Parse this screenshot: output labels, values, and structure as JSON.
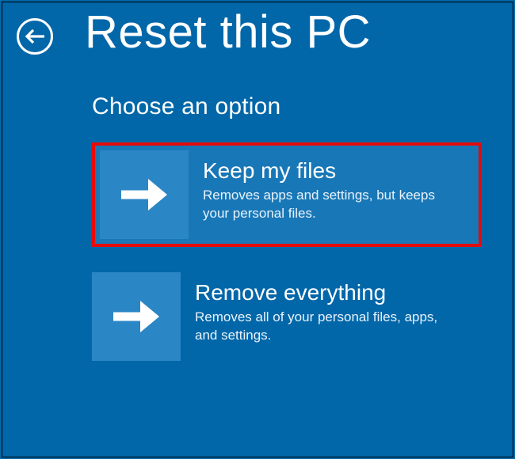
{
  "header": {
    "title": "Reset this PC"
  },
  "subtitle": "Choose an option",
  "options": [
    {
      "title": "Keep my files",
      "description": "Removes apps and settings, but keeps your personal files.",
      "highlighted": true
    },
    {
      "title": "Remove everything",
      "description": "Removes all of your personal files, apps, and settings.",
      "highlighted": false
    }
  ]
}
